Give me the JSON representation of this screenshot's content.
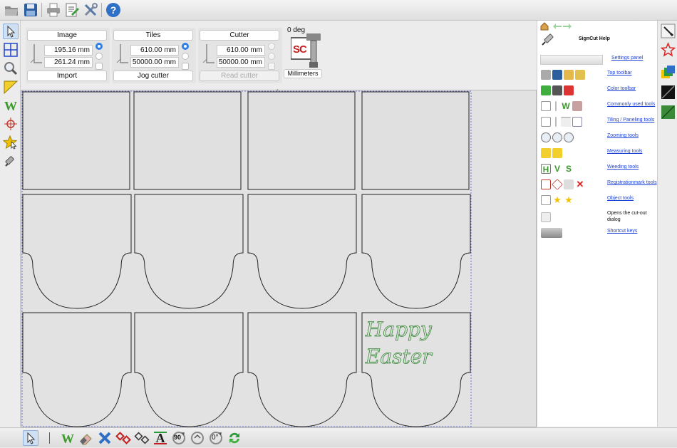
{
  "top_toolbar": {
    "icons": [
      "open-folder-icon",
      "save-icon",
      "print-icon",
      "edit-document-icon",
      "tools-icon",
      "help-icon"
    ]
  },
  "left_toolbar": {
    "icons": [
      "select-arrow-icon",
      "tiling-grid-icon",
      "zoom-icon",
      "measure-ruler-icon",
      "weeding-w-icon",
      "registration-mark-icon",
      "star-object-icon",
      "cutter-knife-icon"
    ]
  },
  "panel": {
    "image": {
      "button_label": "Image",
      "x_value": "195.16 mm",
      "y_value": "261.24 mm",
      "action_label": "Import"
    },
    "tiles": {
      "button_label": "Tiles",
      "x_value": "610.00 mm",
      "y_value": "50000.00 mm",
      "action_label": "Jog cutter"
    },
    "cutter": {
      "button_label": "Cutter",
      "x_value": "610.00 mm",
      "y_value": "50000.00 mm",
      "action_label": "Read cutter"
    },
    "rotation_label": "0 deg",
    "logo_text": "SC",
    "units_button": "Millimeters"
  },
  "canvas": {
    "design_text_line1": "Happy",
    "design_text_line2": "Easter",
    "design_color": "#3a8a3a",
    "cut_line_color": "#222222",
    "border_color": "#4a5ad0"
  },
  "help": {
    "nav_icons": [
      "home-icon",
      "back-arrow-icon",
      "forward-arrow-icon"
    ],
    "title": "SignCut Help",
    "items": [
      {
        "label": "Settings panel",
        "link": true
      },
      {
        "label": "Top toolbar",
        "link": true
      },
      {
        "label": "Color toolbar",
        "link": true
      },
      {
        "label": "Commonly used tools",
        "link": true
      },
      {
        "label": "Tiling / Paneling tools",
        "link": true
      },
      {
        "label": "Zooming tools",
        "link": true
      },
      {
        "label": "Measuring tools",
        "link": true
      },
      {
        "label": "Weeding tools",
        "link": true
      },
      {
        "label": "Registrationmark tools",
        "link": true
      },
      {
        "label": "Object tools",
        "link": true
      },
      {
        "label": "Opens the cut-out dialog",
        "link": false
      },
      {
        "label": "Shortcut keys",
        "link": true
      }
    ],
    "link_color": "#1a3fd6"
  },
  "color_toolbar": {
    "icons": [
      "pick-color-icon",
      "star-outline-icon",
      "color-layers-icon",
      "black-fill-icon",
      "green-fill-icon"
    ]
  },
  "bottom_toolbar": {
    "icons": [
      "select-arrow-icon",
      "weed-w-icon",
      "eraser-icon",
      "delete-x-icon",
      "node-red-icon",
      "node-outline-icon",
      "text-a-icon",
      "rotate-90-icon",
      "rotate-free-icon",
      "rotate-0-icon",
      "refresh-icon"
    ],
    "rotate_90_label": "90",
    "rotate_0_label": "0°"
  }
}
